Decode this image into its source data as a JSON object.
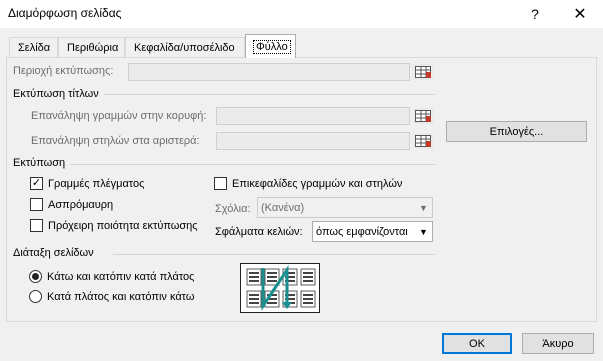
{
  "window": {
    "title": "Διαμόρφωση σελίδας",
    "help_label": "?",
    "close_label": "✕"
  },
  "tabs": [
    {
      "label": "Σελίδα",
      "active": false
    },
    {
      "label": "Περιθώρια",
      "active": false
    },
    {
      "label": "Κεφαλίδα/υποσέλιδο",
      "active": false
    },
    {
      "label": "Φύλλο",
      "active": true
    }
  ],
  "print_area": {
    "label": "Περιοχή εκτύπωσης:",
    "value": ""
  },
  "print_titles": {
    "heading": "Εκτύπωση τίτλων",
    "rows_label": "Επανάληψη γραμμών στην κορυφή:",
    "rows_value": "",
    "cols_label": "Επανάληψη στηλών στα αριστερά:",
    "cols_value": ""
  },
  "options_button": "Επιλογές...",
  "print": {
    "heading": "Εκτύπωση",
    "gridlines": {
      "label": "Γραμμές πλέγματος",
      "checked": true,
      "mark": "✓"
    },
    "black_white": {
      "label": "Ασπρόμαυρη",
      "checked": false
    },
    "draft_quality": {
      "label": "Πρόχειρη ποιότητα εκτύπωσης",
      "checked": false
    },
    "row_col_headings": {
      "label": "Επικεφαλίδες γραμμών και στηλών",
      "checked": false
    },
    "comments_label": "Σχόλια:",
    "comments_value": "(Κανένα)",
    "cell_errors_label": "Σφάλματα κελιών:",
    "cell_errors_value": "όπως εμφανίζονται"
  },
  "page_order": {
    "heading": "Διάταξη σελίδων",
    "down_then_over": {
      "label": "Κάτω και κατόπιν κατά πλάτος",
      "selected": true
    },
    "over_then_down": {
      "label": "Κατά πλάτος και κατόπιν κάτω",
      "selected": false
    }
  },
  "buttons": {
    "ok": "OK",
    "cancel": "Άκυρο"
  },
  "colors": {
    "accent": "#0078d7",
    "order_arrow": "#1a8f8f"
  }
}
